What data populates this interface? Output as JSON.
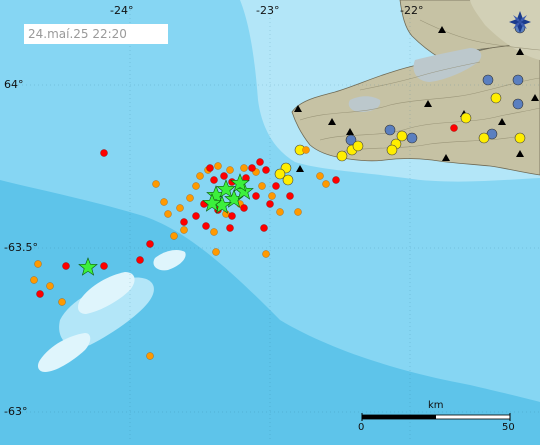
{
  "timestamp": "24.maí.25  22:20",
  "longitude_labels": [
    "-24°",
    "-23°",
    "-22°"
  ],
  "latitude_labels": [
    "64°",
    "-63.5°",
    "-63°"
  ],
  "scale_bar": {
    "unit": "km",
    "start": "0",
    "end": "50"
  },
  "colors": {
    "sea_deep": "#5ec4ea",
    "sea_mid": "#86d6f3",
    "sea_shallow": "#b3e6f8",
    "land": "#c6c2a4",
    "highland": "#bcc8cc",
    "quake_red": "#ff0000",
    "quake_orange": "#ff9a00",
    "quake_yellow": "#ffee00",
    "quake_blue": "#5a7fc0",
    "star_green": "#3cf03c",
    "station_black": "#000000"
  },
  "legend_icons": [
    "earthquake-dot-red",
    "earthquake-dot-orange",
    "earthquake-dot-yellow",
    "earthquake-dot-blue",
    "large-quake-star-green",
    "seismic-station-triangle"
  ],
  "compass_icon": "compass-rose-icon"
}
